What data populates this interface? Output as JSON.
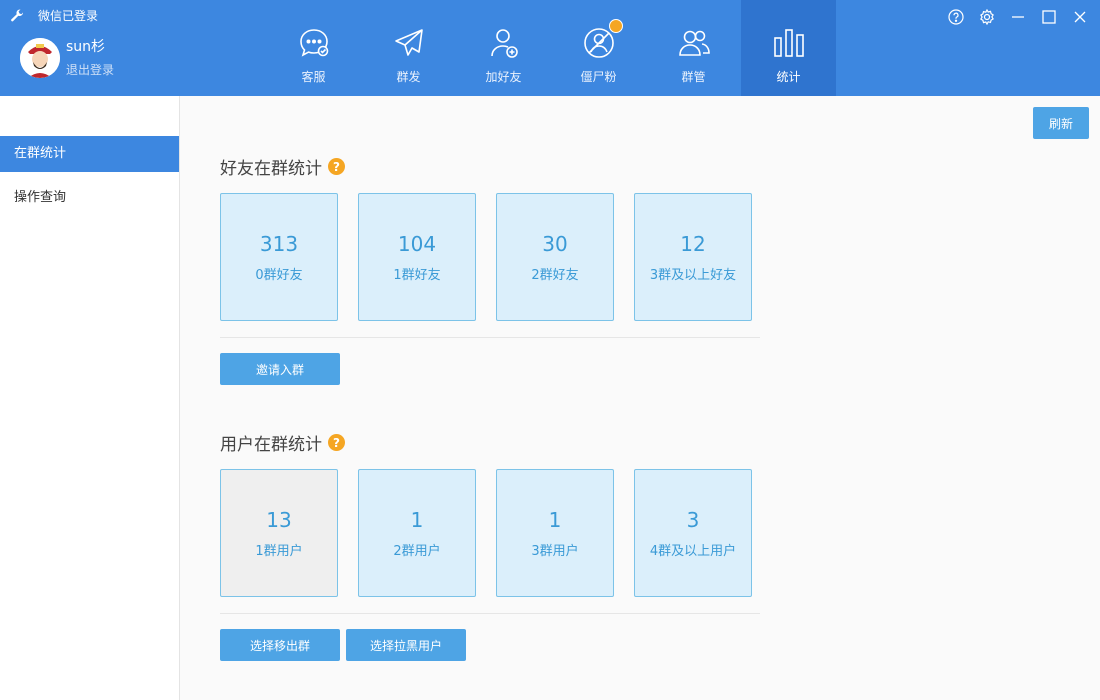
{
  "app": {
    "title": "微信已登录"
  },
  "user": {
    "name": "sun杉",
    "logout": "退出登录"
  },
  "nav": [
    {
      "label": "客服"
    },
    {
      "label": "群发"
    },
    {
      "label": "加好友"
    },
    {
      "label": "僵尸粉"
    },
    {
      "label": "群管"
    },
    {
      "label": "统计"
    }
  ],
  "sidebar": {
    "items": [
      {
        "label": "在群统计"
      },
      {
        "label": "操作查询"
      }
    ]
  },
  "main": {
    "refresh": "刷新",
    "friends": {
      "title": "好友在群统计",
      "cards": [
        {
          "value": "313",
          "label": "0群好友"
        },
        {
          "value": "104",
          "label": "1群好友"
        },
        {
          "value": "30",
          "label": "2群好友"
        },
        {
          "value": "12",
          "label": "3群及以上好友"
        }
      ],
      "invite": "邀请入群"
    },
    "users": {
      "title": "用户在群统计",
      "cards": [
        {
          "value": "13",
          "label": "1群用户"
        },
        {
          "value": "1",
          "label": "2群用户"
        },
        {
          "value": "1",
          "label": "3群用户"
        },
        {
          "value": "3",
          "label": "4群及以上用户"
        }
      ],
      "remove": "选择移出群",
      "blacklist": "选择拉黑用户"
    },
    "help_glyph": "?"
  },
  "colors": {
    "header": "#3d87e0",
    "accent": "#4ea4e5",
    "help": "#f5a623",
    "card_bg": "#dbeffb",
    "card_text": "#3a9ad6"
  }
}
